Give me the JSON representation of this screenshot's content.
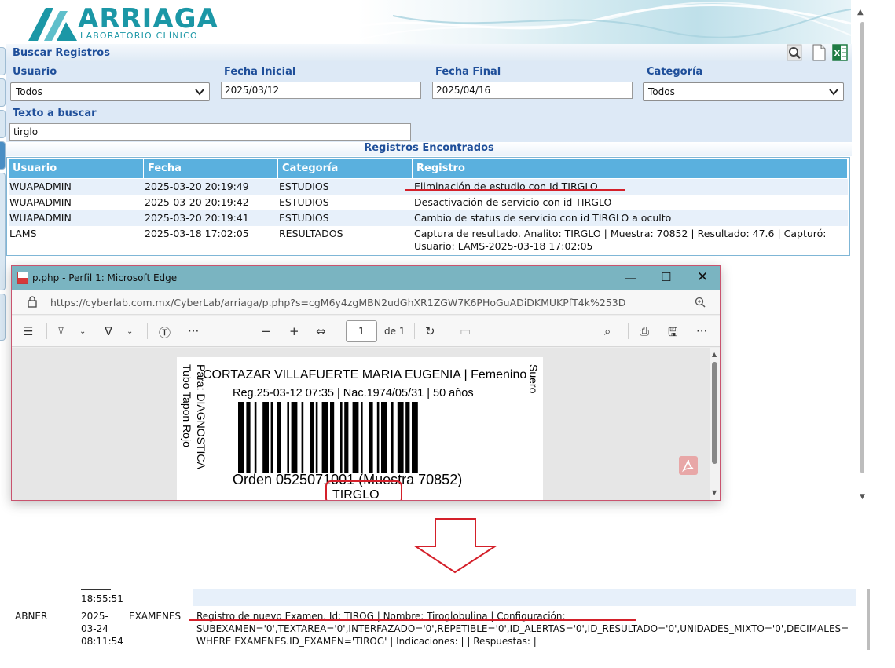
{
  "brand": {
    "name": "ARRIAGA",
    "subtitle": "LABORATORIO CLÍNICO"
  },
  "search": {
    "title": "Buscar Registros",
    "usuario_label": "Usuario",
    "usuario_value": "Todos",
    "fecha_inicial_label": "Fecha Inicial",
    "fecha_inicial_value": "2025/03/12",
    "fecha_final_label": "Fecha Final",
    "fecha_final_value": "2025/04/16",
    "categoria_label": "Categoría",
    "categoria_value": "Todos",
    "texto_label": "Texto a buscar",
    "texto_value": "tirglo",
    "tools": [
      "magnifier-icon",
      "document-icon",
      "excel-icon"
    ]
  },
  "results": {
    "title": "Registros Encontrados",
    "headers": [
      "Usuario",
      "Fecha",
      "Categoría",
      "Registro"
    ],
    "rows": [
      [
        "WUAPADMIN",
        "2025-03-20 20:19:49",
        "ESTUDIOS",
        "Eliminación de estudio con Id TIRGLO"
      ],
      [
        "WUAPADMIN",
        "2025-03-20 20:19:42",
        "ESTUDIOS",
        "Desactivación de servicio con id TIRGLO"
      ],
      [
        "WUAPADMIN",
        "2025-03-20 20:19:41",
        "ESTUDIOS",
        "Cambio de status de servicio con id TIRGLO a oculto"
      ],
      [
        "LAMS",
        "2025-03-18 17:02:05",
        "RESULTADOS",
        "Captura de resultado. Analito: TIRGLO | Muestra: 70852 | Resultado: 47.6 | Capturó:",
        "Usuario: LAMS-2025-03-18 17:02:05"
      ]
    ],
    "highlight_color": "#d4202a"
  },
  "edge": {
    "window_title": "p.php - Perfil 1: Microsoft Edge",
    "url": "https://cyberlab.com.mx/CyberLab/arriaga/p.php?s=cgM6y4zgMBN2udGhXR1ZGW7K6PHoGuADiDKMUKPfT4k%253D",
    "page_number": "1",
    "page_total": "de 1",
    "label": {
      "patient": "CORTAZAR VILLAFUERTE MARIA EUGENIA | Femenino",
      "reg": "Reg.25-03-12 07:35 | Nac.1974/05/31 | 50 años",
      "order": "Orden 0525071001 (Muestra 70852)",
      "test": "TIRGLO",
      "side_left_1": "Para: DIAGNOSTICA",
      "side_left_2": "Tubo Tapon Rojo",
      "side_right": "Suero"
    }
  },
  "bottom": {
    "partial_row": {
      "date_partial": "18:55:51"
    },
    "row": {
      "usuario": "ABNER",
      "fecha_1": "2025-",
      "fecha_2": "03-24",
      "fecha_3": "08:11:54",
      "categoria": "EXAMENES",
      "registro_1": "Registro de nuevo Examen. Id: TIROG | Nombre: Tiroglobulina | Configuración:",
      "registro_2": "SUBEXAMEN='0',TEXTAREA='0',INTERFAZADO='0',REPETIBLE='0',ID_ALERTAS='0',ID_RESULTADO='0',UNIDADES_MIXTO='0',DECIMALES=",
      "registro_3": "WHERE EXAMENES.ID_EXAMEN='TIROG' | Indicaciones: | | Respuestas: |"
    }
  },
  "colors": {
    "accent": "#1f4f9a",
    "header_blue": "#5ab0de",
    "teal": "#1b97a6",
    "annotation_red": "#d4202a"
  }
}
